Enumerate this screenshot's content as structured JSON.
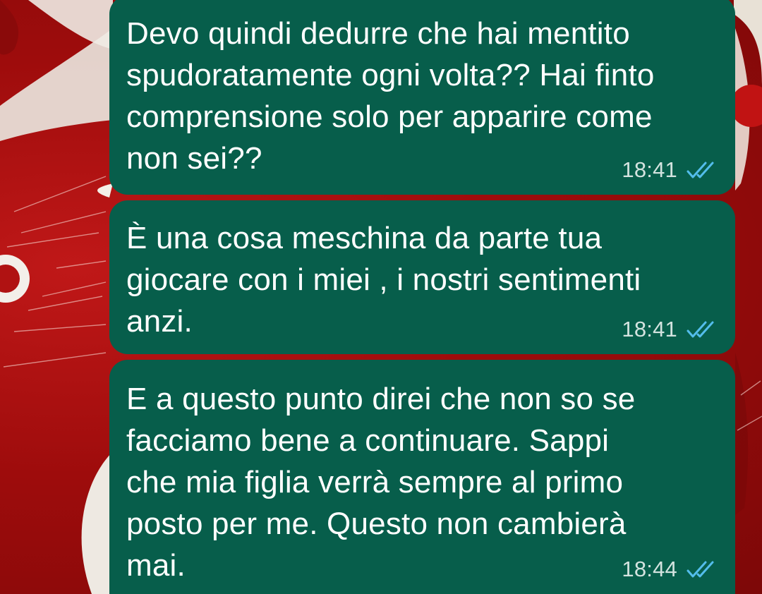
{
  "messages": [
    {
      "text": "Devo quindi dedurre che hai mentito\nspudoratamente ogni volta?? Hai finto\ncomprensione solo per apparire come\nnon sei??",
      "time": "18:41",
      "status_icon": "double-check-read-icon"
    },
    {
      "text": "È una cosa meschina da parte tua\ngiocare con i miei , i nostri sentimenti\nanzi.",
      "time": "18:41",
      "status_icon": "double-check-read-icon"
    },
    {
      "text": "E a questo punto direi che non so se\nfacciamo bene a continuare. Sappi\nche mia figlia verrà sempre al primo\nposto per me. Questo non cambierà\nmai.",
      "time": "18:44",
      "status_icon": "double-check-read-icon"
    }
  ],
  "colors": {
    "bubble": "#075e4b",
    "text": "#ffffff",
    "time": "#d3e3df",
    "read_ticks": "#53bdeb",
    "wallpaper": "#a80d0f"
  }
}
